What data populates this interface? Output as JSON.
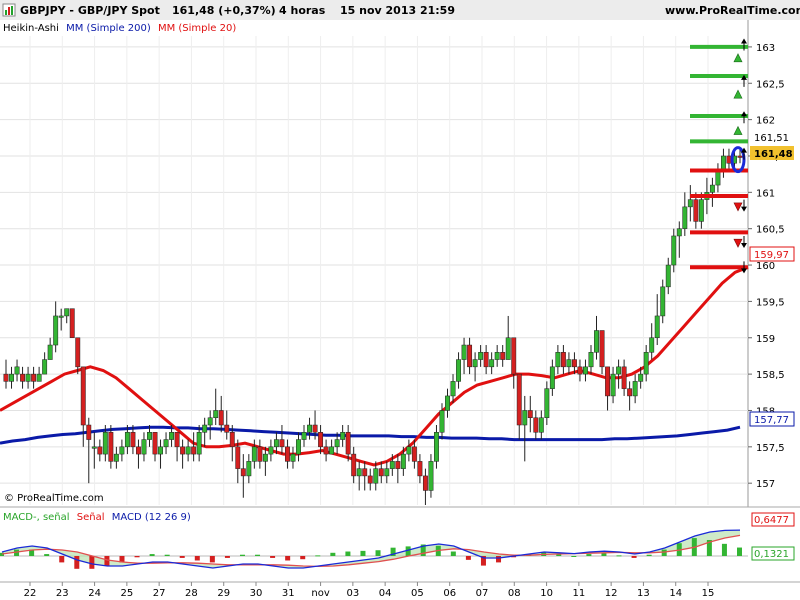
{
  "header": {
    "title": "GBPJPY - GBP/JPY Spot",
    "price_change": "161,48 (+0,37%)",
    "timeframe": "4 horas",
    "datetime": "15 nov 2013 21:59",
    "site": "www.ProRealTime.com"
  },
  "indicators": {
    "heikin_ashi": "Heikin-Ashi",
    "ma200": "MM (Simple 200)",
    "ma20": "MM (Simple 20)",
    "macd_label": "MACD-, señal",
    "signal_label": "Señal",
    "macd_name": "MACD (12 26 9)"
  },
  "copyright": "© ProRealTime.com",
  "right_labels": {
    "price_a": "161,51",
    "price_current": "161,48",
    "ma200_value": "157,77",
    "red_level": "159,97",
    "macd_a": "0,6477",
    "macd_b": "0,1321"
  },
  "colors": {
    "bull": "#33b533",
    "bear": "#d42020",
    "ma200": "#0a1aa8",
    "ma20": "#e01010",
    "macd_hist_pos": "#33b533",
    "macd_hist_neg": "#d42020",
    "current_badge": "#f2c12e"
  },
  "chart_data": {
    "type": "candlestick",
    "instrument": "GBPJPY",
    "y_ticks": [
      "163",
      "162,5",
      "162",
      "161,5",
      "161",
      "160,5",
      "160",
      "159,5",
      "159",
      "158,5",
      "158",
      "157,5",
      "157"
    ],
    "y_range": [
      156.7,
      163.15
    ],
    "x_labels": [
      "22",
      "23",
      "24",
      "25",
      "27",
      "28",
      "29",
      "30",
      "31",
      "nov",
      "03",
      "04",
      "05",
      "06",
      "07",
      "08",
      "10",
      "11",
      "12",
      "13",
      "14",
      "15"
    ],
    "candles": [
      [
        158.5,
        158.7,
        158.3,
        158.4
      ],
      [
        158.4,
        158.6,
        158.3,
        158.5
      ],
      [
        158.5,
        158.7,
        158.4,
        158.6
      ],
      [
        158.5,
        158.6,
        158.3,
        158.4
      ],
      [
        158.4,
        158.6,
        158.3,
        158.5
      ],
      [
        158.5,
        158.6,
        158.3,
        158.4
      ],
      [
        158.4,
        158.6,
        158.4,
        158.5
      ],
      [
        158.5,
        158.8,
        158.5,
        158.7
      ],
      [
        158.7,
        159.0,
        158.7,
        158.9
      ],
      [
        158.9,
        159.5,
        158.8,
        159.3
      ],
      [
        159.3,
        159.4,
        159.1,
        159.3
      ],
      [
        159.3,
        159.4,
        159.2,
        159.4
      ],
      [
        159.4,
        159.4,
        159.0,
        159.0
      ],
      [
        159.0,
        159.0,
        158.5,
        158.6
      ],
      [
        158.6,
        158.6,
        157.5,
        157.8
      ],
      [
        157.8,
        157.9,
        157.0,
        157.6
      ],
      [
        157.5,
        157.7,
        157.2,
        157.5
      ],
      [
        157.5,
        157.6,
        157.3,
        157.4
      ],
      [
        157.4,
        157.8,
        157.3,
        157.7
      ],
      [
        157.7,
        157.8,
        157.2,
        157.3
      ],
      [
        157.3,
        157.5,
        157.2,
        157.4
      ],
      [
        157.4,
        157.6,
        157.3,
        157.5
      ],
      [
        157.5,
        157.8,
        157.4,
        157.7
      ],
      [
        157.7,
        157.8,
        157.4,
        157.5
      ],
      [
        157.5,
        157.6,
        157.2,
        157.4
      ],
      [
        157.4,
        157.7,
        157.3,
        157.6
      ],
      [
        157.6,
        157.8,
        157.5,
        157.7
      ],
      [
        157.7,
        157.7,
        157.3,
        157.4
      ],
      [
        157.4,
        157.6,
        157.2,
        157.5
      ],
      [
        157.5,
        157.7,
        157.4,
        157.6
      ],
      [
        157.6,
        157.8,
        157.5,
        157.7
      ],
      [
        157.7,
        157.7,
        157.3,
        157.5
      ],
      [
        157.5,
        157.6,
        157.2,
        157.4
      ],
      [
        157.4,
        157.6,
        157.3,
        157.5
      ],
      [
        157.5,
        157.7,
        157.3,
        157.4
      ],
      [
        157.4,
        157.8,
        157.3,
        157.7
      ],
      [
        157.7,
        157.9,
        157.5,
        157.8
      ],
      [
        157.8,
        158.0,
        157.6,
        157.9
      ],
      [
        157.9,
        158.3,
        157.8,
        158.0
      ],
      [
        158.0,
        158.2,
        157.7,
        157.8
      ],
      [
        157.8,
        158.0,
        157.6,
        157.7
      ],
      [
        157.7,
        157.8,
        157.3,
        157.5
      ],
      [
        157.5,
        157.6,
        157.0,
        157.2
      ],
      [
        157.2,
        157.4,
        156.8,
        157.1
      ],
      [
        157.1,
        157.4,
        157.0,
        157.3
      ],
      [
        157.3,
        157.6,
        157.2,
        157.5
      ],
      [
        157.5,
        157.6,
        157.2,
        157.3
      ],
      [
        157.3,
        157.5,
        157.1,
        157.4
      ],
      [
        157.4,
        157.6,
        157.3,
        157.5
      ],
      [
        157.5,
        157.7,
        157.4,
        157.6
      ],
      [
        157.6,
        157.8,
        157.4,
        157.5
      ],
      [
        157.5,
        157.6,
        157.2,
        157.3
      ],
      [
        157.3,
        157.5,
        157.2,
        157.4
      ],
      [
        157.4,
        157.7,
        157.3,
        157.6
      ],
      [
        157.6,
        157.8,
        157.5,
        157.7
      ],
      [
        157.7,
        157.9,
        157.6,
        157.8
      ],
      [
        157.8,
        158.0,
        157.6,
        157.7
      ],
      [
        157.7,
        157.8,
        157.4,
        157.5
      ],
      [
        157.5,
        157.6,
        157.3,
        157.4
      ],
      [
        157.4,
        157.6,
        157.4,
        157.5
      ],
      [
        157.5,
        157.7,
        157.4,
        157.6
      ],
      [
        157.6,
        157.8,
        157.5,
        157.7
      ],
      [
        157.7,
        157.8,
        157.3,
        157.4
      ],
      [
        157.4,
        157.5,
        157.0,
        157.1
      ],
      [
        157.1,
        157.3,
        156.9,
        157.2
      ],
      [
        157.2,
        157.3,
        156.9,
        157.1
      ],
      [
        157.1,
        157.2,
        156.9,
        157.0
      ],
      [
        157.0,
        157.3,
        156.9,
        157.2
      ],
      [
        157.2,
        157.3,
        157.0,
        157.1
      ],
      [
        157.1,
        157.3,
        157.0,
        157.2
      ],
      [
        157.2,
        157.4,
        157.1,
        157.3
      ],
      [
        157.3,
        157.4,
        157.0,
        157.2
      ],
      [
        157.2,
        157.5,
        157.1,
        157.4
      ],
      [
        157.4,
        157.6,
        157.3,
        157.5
      ],
      [
        157.5,
        157.6,
        157.2,
        157.3
      ],
      [
        157.3,
        157.4,
        157.0,
        157.1
      ],
      [
        157.1,
        157.2,
        156.7,
        156.9
      ],
      [
        156.9,
        157.4,
        156.8,
        157.3
      ],
      [
        157.3,
        157.8,
        157.2,
        157.7
      ],
      [
        157.7,
        158.1,
        157.6,
        158.0
      ],
      [
        158.0,
        158.3,
        157.9,
        158.2
      ],
      [
        158.2,
        158.5,
        158.1,
        158.4
      ],
      [
        158.4,
        158.8,
        158.3,
        158.7
      ],
      [
        158.7,
        159.0,
        158.5,
        158.9
      ],
      [
        158.9,
        159.0,
        158.5,
        158.6
      ],
      [
        158.6,
        158.8,
        158.4,
        158.7
      ],
      [
        158.7,
        158.9,
        158.6,
        158.8
      ],
      [
        158.8,
        158.9,
        158.5,
        158.6
      ],
      [
        158.6,
        158.8,
        158.5,
        158.7
      ],
      [
        158.7,
        158.9,
        158.6,
        158.8
      ],
      [
        158.8,
        158.9,
        158.6,
        158.7
      ],
      [
        158.7,
        159.3,
        158.7,
        159.0
      ],
      [
        159.0,
        159.0,
        158.3,
        158.5
      ],
      [
        158.5,
        158.5,
        157.6,
        157.8
      ],
      [
        157.8,
        158.2,
        157.3,
        158.0
      ],
      [
        158.0,
        158.2,
        157.7,
        157.9
      ],
      [
        157.9,
        158.0,
        157.6,
        157.7
      ],
      [
        157.7,
        158.0,
        157.6,
        157.9
      ],
      [
        157.9,
        158.4,
        157.8,
        158.3
      ],
      [
        158.3,
        158.7,
        158.2,
        158.6
      ],
      [
        158.6,
        158.9,
        158.5,
        158.8
      ],
      [
        158.8,
        158.9,
        158.5,
        158.6
      ],
      [
        158.6,
        158.8,
        158.5,
        158.7
      ],
      [
        158.7,
        158.8,
        158.5,
        158.6
      ],
      [
        158.6,
        158.7,
        158.4,
        158.5
      ],
      [
        158.5,
        158.7,
        158.4,
        158.6
      ],
      [
        158.6,
        158.9,
        158.5,
        158.8
      ],
      [
        158.8,
        159.3,
        158.7,
        159.1
      ],
      [
        159.1,
        159.1,
        158.5,
        158.6
      ],
      [
        158.6,
        158.6,
        158.0,
        158.2
      ],
      [
        158.2,
        158.6,
        158.1,
        158.5
      ],
      [
        158.5,
        158.7,
        158.3,
        158.6
      ],
      [
        158.6,
        158.7,
        158.2,
        158.3
      ],
      [
        158.3,
        158.4,
        158.0,
        158.2
      ],
      [
        158.2,
        158.5,
        158.1,
        158.4
      ],
      [
        158.4,
        158.6,
        158.3,
        158.5
      ],
      [
        158.5,
        158.9,
        158.4,
        158.8
      ],
      [
        158.8,
        159.2,
        158.7,
        159.0
      ],
      [
        159.0,
        159.6,
        158.9,
        159.3
      ],
      [
        159.3,
        159.8,
        159.2,
        159.7
      ],
      [
        159.7,
        160.1,
        159.6,
        160.0
      ],
      [
        160.0,
        160.5,
        159.9,
        160.4
      ],
      [
        160.4,
        160.6,
        160.1,
        160.5
      ],
      [
        160.5,
        161.0,
        160.4,
        160.8
      ],
      [
        160.8,
        161.1,
        160.6,
        160.9
      ],
      [
        160.9,
        161.0,
        160.5,
        160.6
      ],
      [
        160.6,
        161.0,
        160.5,
        160.9
      ],
      [
        160.9,
        161.2,
        160.7,
        161.0
      ],
      [
        161.0,
        161.2,
        160.8,
        161.1
      ],
      [
        161.1,
        161.4,
        161.0,
        161.3
      ],
      [
        161.3,
        161.6,
        161.2,
        161.5
      ],
      [
        161.5,
        161.6,
        161.3,
        161.4
      ],
      [
        161.4,
        161.6,
        161.3,
        161.5
      ],
      [
        161.5,
        161.6,
        161.4,
        161.48
      ]
    ],
    "ma200": [
      157.55,
      157.58,
      157.6,
      157.63,
      157.65,
      157.67,
      157.68,
      157.7,
      157.72,
      157.74,
      157.75,
      157.76,
      157.77,
      157.77,
      157.76,
      157.76,
      157.75,
      157.75,
      157.74,
      157.73,
      157.72,
      157.71,
      157.7,
      157.69,
      157.68,
      157.67,
      157.66,
      157.66,
      157.65,
      157.65,
      157.65,
      157.65,
      157.64,
      157.64,
      157.63,
      157.63,
      157.62,
      157.62,
      157.62,
      157.61,
      157.61,
      157.6,
      157.6,
      157.6,
      157.6,
      157.6,
      157.6,
      157.6,
      157.6,
      157.61,
      157.61,
      157.62,
      157.63,
      157.64,
      157.65,
      157.67,
      157.69,
      157.71,
      157.73,
      157.77
    ],
    "ma20": [
      158.0,
      158.1,
      158.2,
      158.3,
      158.4,
      158.5,
      158.55,
      158.6,
      158.55,
      158.45,
      158.3,
      158.15,
      158.0,
      157.85,
      157.7,
      157.55,
      157.5,
      157.5,
      157.52,
      157.55,
      157.5,
      157.45,
      157.4,
      157.4,
      157.42,
      157.45,
      157.4,
      157.35,
      157.3,
      157.25,
      157.3,
      157.4,
      157.55,
      157.75,
      157.95,
      158.1,
      158.25,
      158.35,
      158.4,
      158.45,
      158.5,
      158.5,
      158.48,
      158.45,
      158.5,
      158.55,
      158.5,
      158.45,
      158.45,
      158.5,
      158.6,
      158.75,
      158.95,
      159.15,
      159.35,
      159.55,
      159.75,
      159.9,
      159.97
    ],
    "target_levels_green": [
      163.0,
      162.6,
      162.05,
      161.7
    ],
    "target_levels_red": [
      161.3,
      160.95,
      160.45,
      159.97
    ],
    "macd": {
      "macd_line": [
        0.1,
        0.2,
        0.25,
        0.2,
        0.05,
        -0.1,
        -0.2,
        -0.25,
        -0.25,
        -0.2,
        -0.15,
        -0.15,
        -0.2,
        -0.25,
        -0.3,
        -0.25,
        -0.2,
        -0.2,
        -0.25,
        -0.3,
        -0.3,
        -0.25,
        -0.2,
        -0.15,
        -0.1,
        -0.05,
        0.05,
        0.15,
        0.25,
        0.3,
        0.25,
        0.1,
        -0.05,
        -0.05,
        0.0,
        0.05,
        0.1,
        0.08,
        0.06,
        0.1,
        0.12,
        0.1,
        0.05,
        0.1,
        0.2,
        0.35,
        0.5,
        0.6,
        0.64,
        0.6477
      ],
      "signal_line": [
        0.05,
        0.1,
        0.15,
        0.17,
        0.15,
        0.1,
        0.0,
        -0.1,
        -0.15,
        -0.18,
        -0.18,
        -0.17,
        -0.17,
        -0.18,
        -0.2,
        -0.22,
        -0.22,
        -0.22,
        -0.22,
        -0.23,
        -0.25,
        -0.26,
        -0.25,
        -0.22,
        -0.18,
        -0.14,
        -0.08,
        0.0,
        0.07,
        0.14,
        0.18,
        0.16,
        0.1,
        0.05,
        0.02,
        0.02,
        0.04,
        0.05,
        0.06,
        0.07,
        0.08,
        0.09,
        0.08,
        0.08,
        0.1,
        0.15,
        0.22,
        0.35,
        0.45,
        0.5156
      ],
      "histogram_last": 0.1321,
      "y_range": [
        -0.55,
        0.85
      ]
    }
  }
}
